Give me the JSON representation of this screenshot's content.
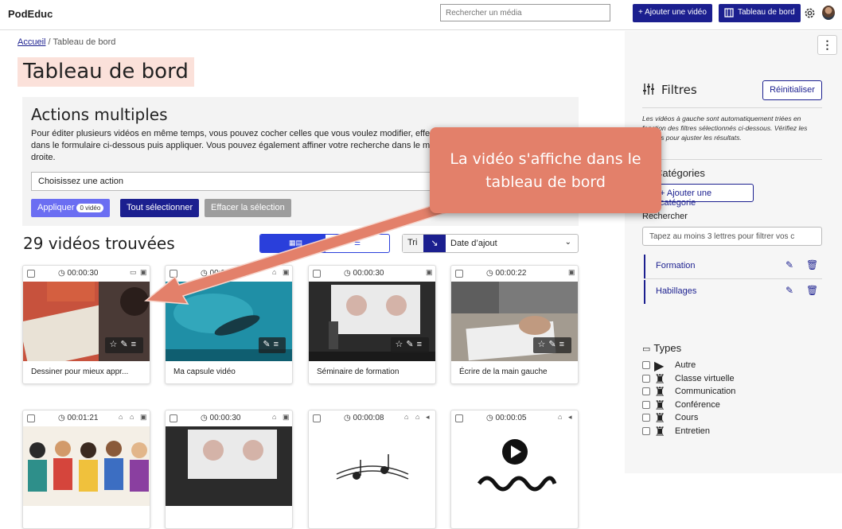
{
  "header": {
    "logo": "PodEduc",
    "search_placeholder": "Rechercher un média",
    "add_video": "+ Ajouter une vidéo",
    "dashboard": "Tableau de bord"
  },
  "breadcrumb": {
    "home": "Accueil",
    "separator": "/",
    "current": "Tableau de bord"
  },
  "page_title": "Tableau de bord",
  "actions": {
    "title": "Actions multiples",
    "description": "Pour éditer plusieurs vidéos en même temps, vous pouvez cocher celles que vous voulez modifier, effectuer dans le formulaire ci-dessous puis appliquer. Vous pouvez également affiner votre recherche dans le menu de droite.",
    "select_value": "Choisissez une action",
    "apply": "Appliquer",
    "apply_badge": "0 vidéo",
    "select_all": "Tout sélectionner",
    "clear": "Effacer la sélection"
  },
  "results": {
    "count_text": "29 vidéos trouvées",
    "sort_label": "Tri",
    "sort_dir": "↘",
    "sort_value": "Date d’ajout"
  },
  "cards": [
    {
      "duration": "00:00:30",
      "title": "Dessiner pour mieux appr..."
    },
    {
      "duration": "00:00:42",
      "title": "Ma capsule vidéo"
    },
    {
      "duration": "00:00:30",
      "title": "Séminaire de formation"
    },
    {
      "duration": "00:00:22",
      "title": "Écrire de la main gauche"
    },
    {
      "duration": "00:01:21",
      "title": ""
    },
    {
      "duration": "00:00:30",
      "title": ""
    },
    {
      "duration": "00:00:08",
      "title": ""
    },
    {
      "duration": "00:00:05",
      "title": ""
    }
  ],
  "sidebar": {
    "filters_title": "Filtres",
    "reset": "Réinitialiser",
    "note": "Les vidéos à gauche sont automatiquement triées en fonction des filtres sélectionnés ci-dessous. Vérifiez les options pour ajuster les résultats.",
    "categories_title": "Catégories",
    "add_category": "+ Ajouter une catégorie",
    "search_label": "Rechercher",
    "search_placeholder": "Tapez au moins 3 lettres pour filtrer vos c",
    "categories": [
      "Formation",
      "Habillages"
    ],
    "types_title": "Types",
    "types": [
      "Autre",
      "Classe virtuelle",
      "Communication",
      "Conférence",
      "Cours",
      "Entretien"
    ]
  },
  "callout": {
    "text": "La vidéo s'affiche dans le tableau de bord"
  }
}
